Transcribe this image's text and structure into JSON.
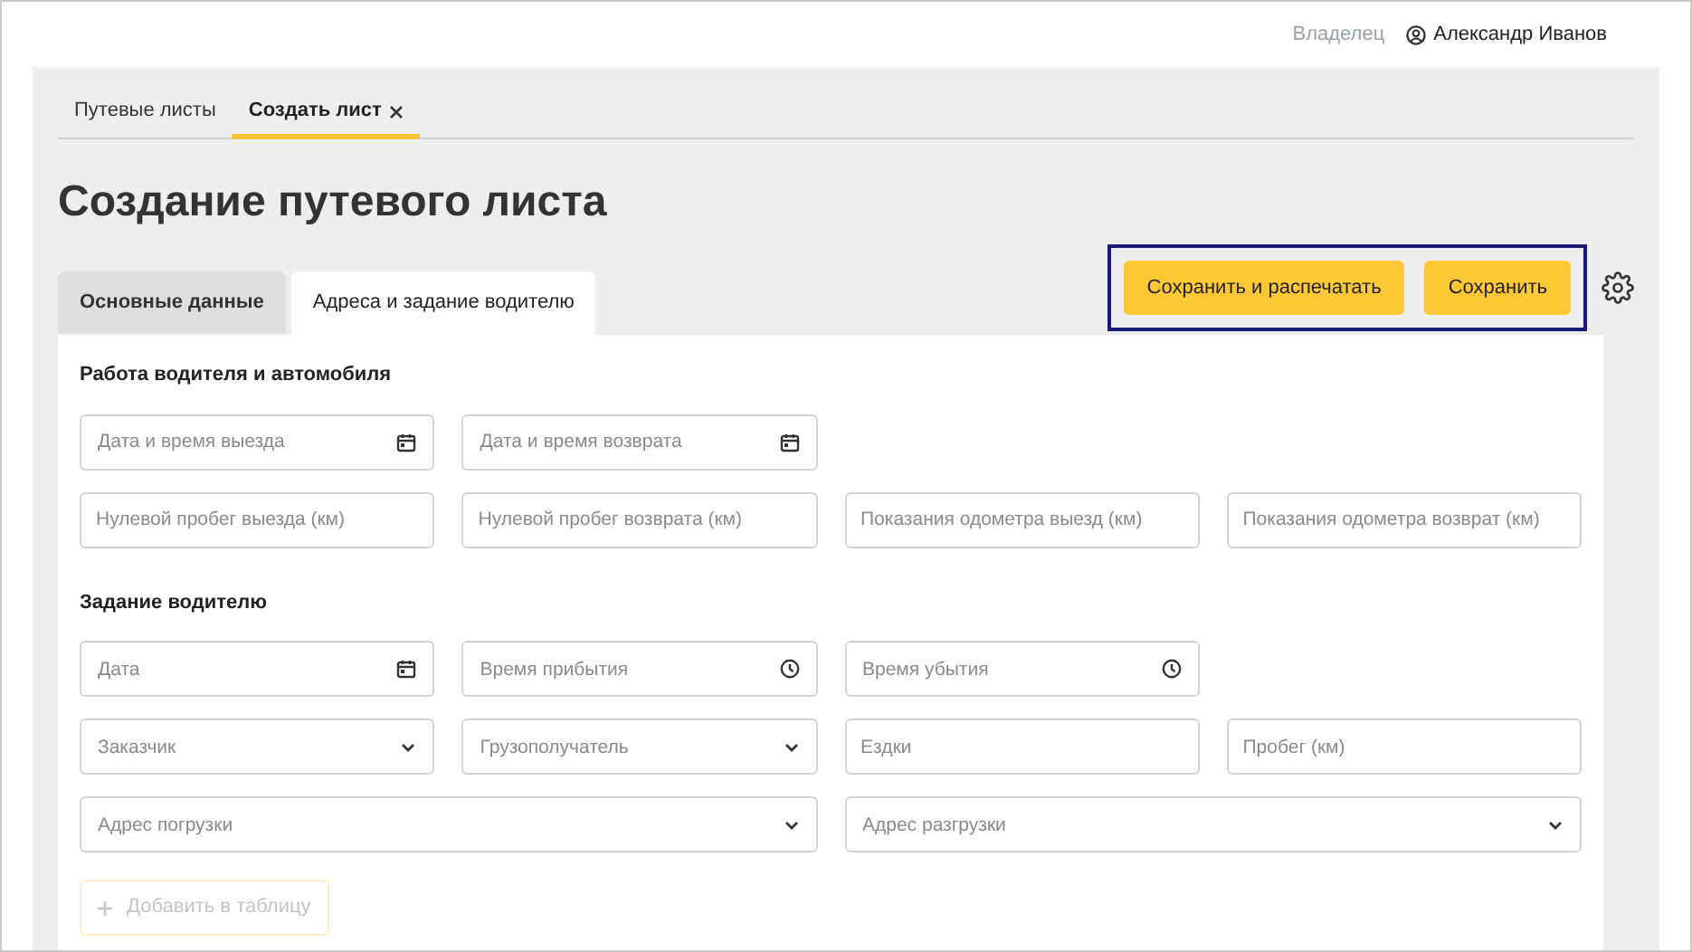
{
  "header": {
    "role": "Владелец",
    "user": "Александр Иванов"
  },
  "page_tabs": [
    {
      "label": "Путевые листы",
      "selected": false,
      "closable": false
    },
    {
      "label": "Создать лист",
      "selected": true,
      "closable": true
    }
  ],
  "title": "Создание путевого листа",
  "form_tabs": [
    {
      "label": "Основные данные",
      "selected": false
    },
    {
      "label": "Адреса и задание водителю",
      "selected": true
    }
  ],
  "actions": {
    "highlighted": true,
    "buttons": [
      "Сохранить и распечатать",
      "Сохранить"
    ]
  },
  "sections": [
    {
      "title": "Работа водителя и автомобиля",
      "rows": [
        [
          {
            "kind": "date",
            "placeholder": "Дата и время выезда"
          },
          {
            "kind": "date",
            "placeholder": "Дата и время возврата"
          }
        ],
        [
          {
            "kind": "text",
            "placeholder": "Нулевой пробег выезда (км)"
          },
          {
            "kind": "text",
            "placeholder": "Нулевой пробег возврата (км)"
          },
          {
            "kind": "text",
            "placeholder": "Показания одометра выезд (км)"
          },
          {
            "kind": "text",
            "placeholder": "Показания одометра возврат (км)"
          }
        ]
      ]
    },
    {
      "title": "Задание водителю",
      "rows": [
        [
          {
            "kind": "date",
            "placeholder": "Дата"
          },
          {
            "kind": "time",
            "placeholder": "Время прибытия"
          },
          {
            "kind": "time",
            "placeholder": "Время убытия"
          }
        ],
        [
          {
            "kind": "select",
            "placeholder": "Заказчик"
          },
          {
            "kind": "select",
            "placeholder": "Грузополучатель"
          },
          {
            "kind": "text",
            "placeholder": "Ездки"
          },
          {
            "kind": "text",
            "placeholder": "Пробег (км)"
          }
        ],
        [
          {
            "kind": "select",
            "colspan": 2,
            "placeholder": "Адрес погрузки"
          },
          {
            "kind": "select",
            "colspan": 2,
            "placeholder": "Адрес разгрузки"
          }
        ]
      ]
    }
  ],
  "add_button": {
    "label": "Добавить в таблицу",
    "disabled": true
  }
}
